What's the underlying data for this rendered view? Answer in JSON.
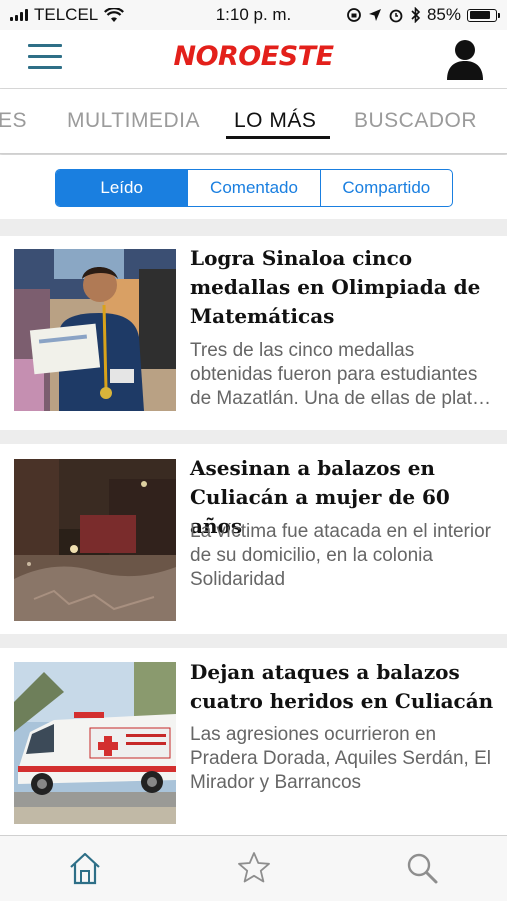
{
  "status_bar": {
    "carrier": "TELCEL",
    "time": "1:10 p. m.",
    "battery": "85%",
    "battery_level": 0.85
  },
  "header": {
    "logo_text": "NOROESTE",
    "menu_icon": "hamburger-menu-icon",
    "profile_icon": "user-silhouette-icon"
  },
  "tabs": [
    {
      "label": "ES"
    },
    {
      "label": "MULTIMEDIA"
    },
    {
      "label": "LO MÁS",
      "active": true
    },
    {
      "label": "BUSCADOR"
    }
  ],
  "segments": [
    {
      "label": "Leído",
      "active": true
    },
    {
      "label": "Comentado"
    },
    {
      "label": "Compartido"
    }
  ],
  "articles": [
    {
      "title": "Logra Sinaloa cinco medallas en Olimpiada de Matemáticas",
      "summary": "Tres de las cinco medallas obtenidas fueron para estudiantes de Mazatlán. Una de ellas de plat…",
      "image": "boy-with-medal-and-diploma"
    },
    {
      "title": "Asesinan a balazos en Culiacán a mujer de 60 años",
      "summary": "La víctima fue atacada en el interior de su domicilio, en la colonia Solidaridad",
      "image": "night-street-scene"
    },
    {
      "title": "Dejan ataques a balazos cuatro heridos en Culiacán",
      "summary": "Las agresiones ocurrieron en Pradera Dorada, Aquiles Serdán, El Mirador y Barrancos",
      "image": "red-cross-ambulance"
    }
  ],
  "bottom_nav": {
    "icons": [
      "home-icon",
      "star-icon",
      "search-icon"
    ]
  },
  "colors": {
    "brand": "#e3201b",
    "accent": "#1a7fe0",
    "nav_active": "#2e6f87"
  }
}
